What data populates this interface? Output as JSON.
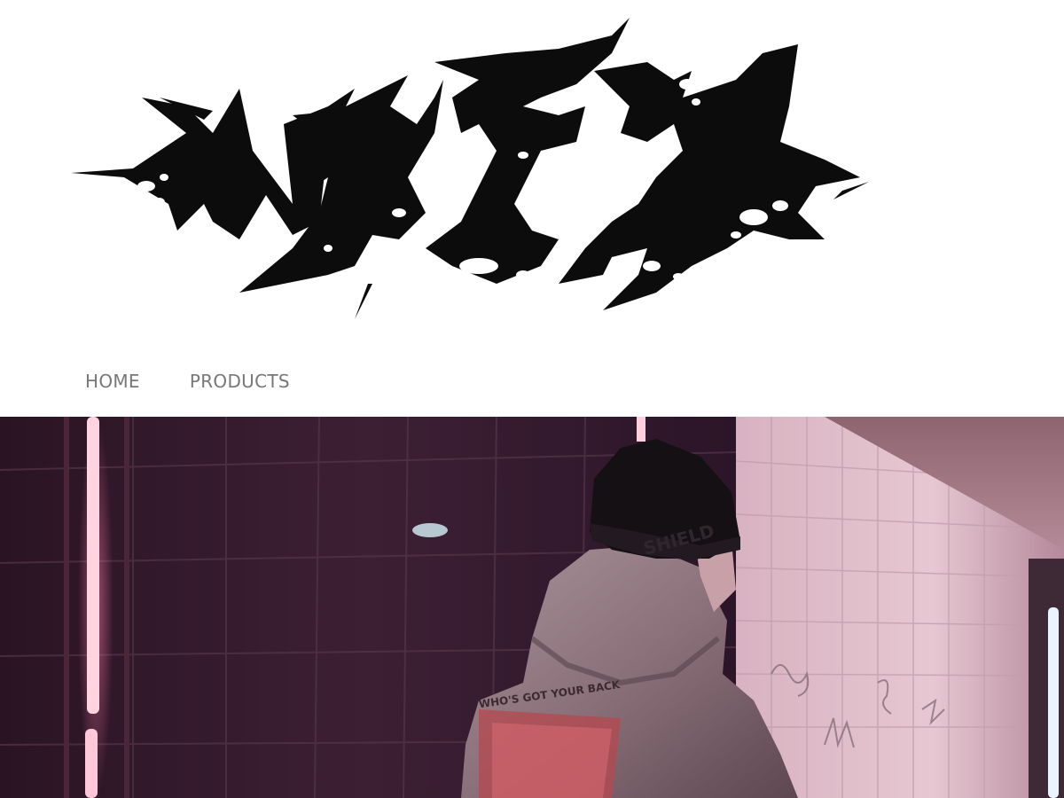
{
  "brand": {
    "logo_text": "NACH",
    "logo_color": "#0c0c0c"
  },
  "nav": {
    "items": [
      {
        "label": "HOME"
      },
      {
        "label": "PRODUCTS"
      }
    ],
    "text_color": "#777777"
  },
  "hero": {
    "hat_text": "SHIELD",
    "hoodie_text": "WHO'S GOT YOUR BACK"
  }
}
